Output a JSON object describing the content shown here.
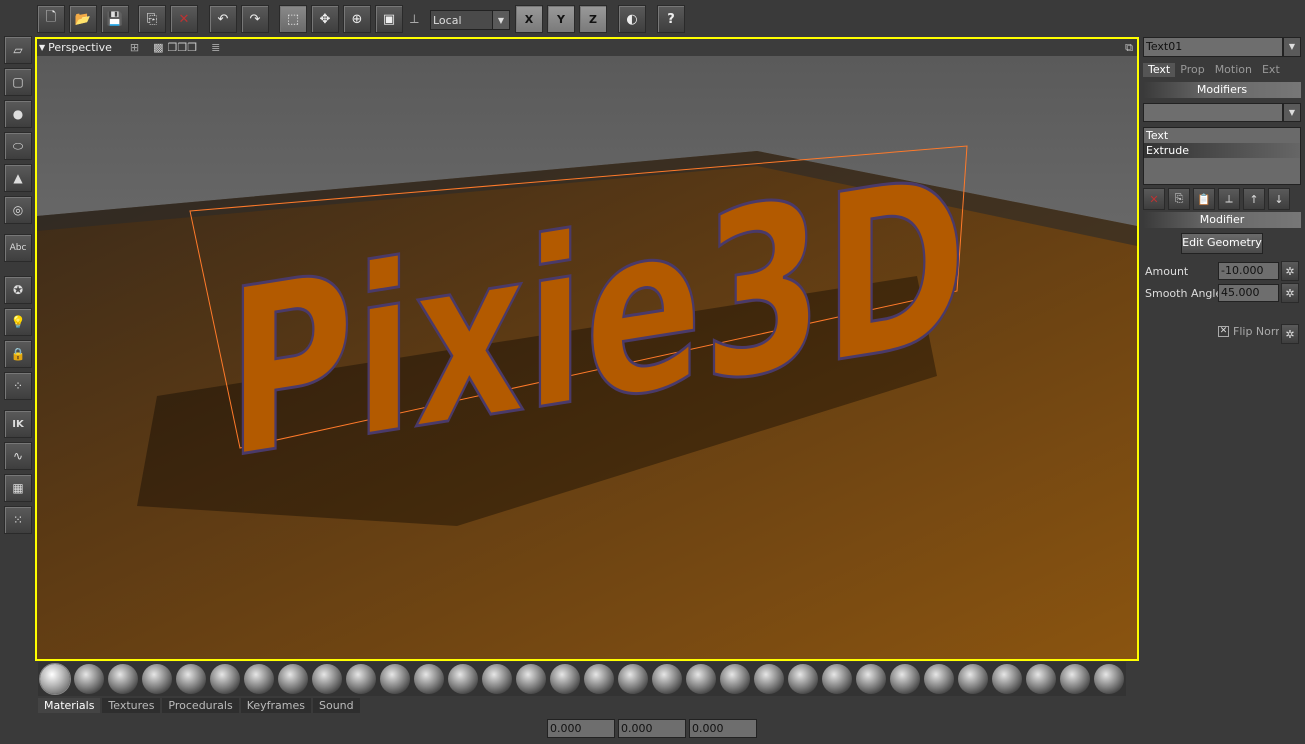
{
  "toolbar": {
    "buttons": [
      {
        "name": "new-file-icon",
        "glyph": "🗋"
      },
      {
        "name": "open-folder-icon",
        "glyph": "📂"
      },
      {
        "name": "save-icon",
        "glyph": "💾"
      },
      {
        "name": "copy-icon",
        "glyph": "⎘"
      },
      {
        "name": "delete-icon",
        "glyph": "✕"
      },
      {
        "name": "undo-icon",
        "glyph": "↶"
      },
      {
        "name": "redo-icon",
        "glyph": "↷"
      },
      {
        "name": "select-icon",
        "glyph": "⬚"
      },
      {
        "name": "move-icon",
        "glyph": "✥"
      },
      {
        "name": "rotate-icon",
        "glyph": "⊕"
      },
      {
        "name": "scale-icon",
        "glyph": "▣"
      }
    ],
    "coord_system": "Local",
    "axes": [
      "X",
      "Y",
      "Z"
    ],
    "render_icon": "render-icon",
    "help_icon": "?"
  },
  "left_tools": [
    {
      "name": "plane-icon",
      "glyph": "▱"
    },
    {
      "name": "cube-icon",
      "glyph": "▢"
    },
    {
      "name": "sphere-icon",
      "glyph": "●"
    },
    {
      "name": "cylinder-icon",
      "glyph": "⬭"
    },
    {
      "name": "cone-icon",
      "glyph": "▲"
    },
    {
      "name": "torus-icon",
      "glyph": "◎"
    },
    {
      "name": "text-icon",
      "glyph": "Abc"
    },
    {
      "name": "camera-icon",
      "glyph": "✪"
    },
    {
      "name": "light-icon",
      "glyph": "💡"
    },
    {
      "name": "lock-icon",
      "glyph": "🔒"
    },
    {
      "name": "particles-icon",
      "glyph": "⁘"
    },
    {
      "name": "ik-icon",
      "glyph": "IK"
    },
    {
      "name": "curve-icon",
      "glyph": "∿"
    },
    {
      "name": "grid-icon",
      "glyph": "▦"
    },
    {
      "name": "dots-icon",
      "glyph": "⁙"
    }
  ],
  "viewport": {
    "label": "Perspective",
    "scene_text": "Pixie3D"
  },
  "right_panel": {
    "object_name": "Text01",
    "tabs": [
      "Text",
      "Prop",
      "Motion",
      "Ext"
    ],
    "modifiers_header": "Modifiers",
    "modifier_list": [
      "Text",
      "Extrude"
    ],
    "modifier_header": "Modifier",
    "edit_geometry": "Edit Geometry",
    "amount_label": "Amount",
    "amount_value": "-10.000",
    "smooth_label": "Smooth Angle",
    "smooth_value": "45.000",
    "flip_label": "Flip Norm"
  },
  "bottom": {
    "tabs": [
      "Materials",
      "Textures",
      "Procedurals",
      "Keyframes",
      "Sound"
    ],
    "coords": [
      "0.000",
      "0.000",
      "0.000"
    ]
  },
  "colors": {
    "selection": "#ffff00",
    "letters": "#b35a00"
  }
}
